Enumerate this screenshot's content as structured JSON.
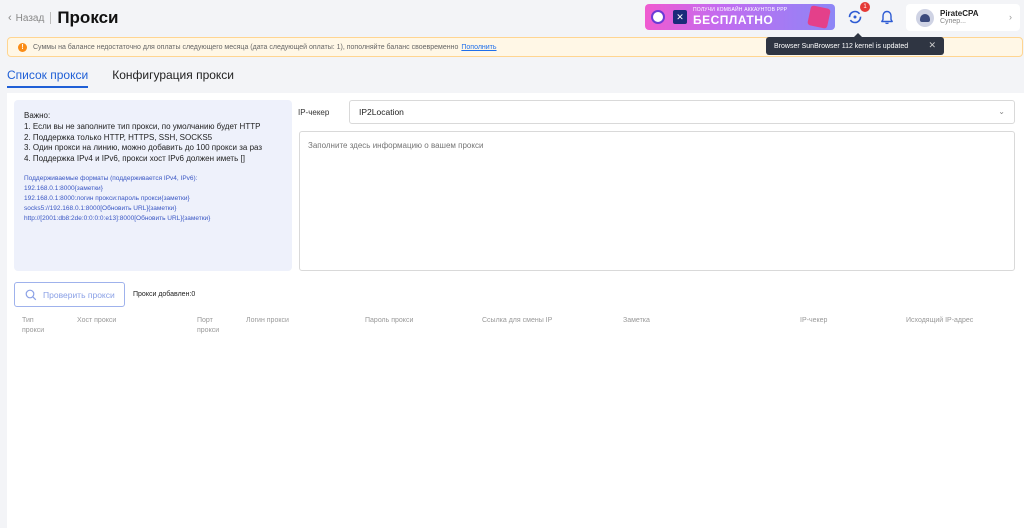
{
  "header": {
    "back_label": "Назад",
    "title": "Прокси"
  },
  "promo": {
    "line1": "ПОЛУЧИ КОМБАЙН АККАУНТОВ PPP",
    "line2": "БЕСПЛАТНО"
  },
  "notifications": {
    "badge_count": "1"
  },
  "user": {
    "name": "PirateCPA",
    "role": "Супер..."
  },
  "alert": {
    "text": "Суммы на балансе недостаточно для оплаты следующего месяца (дата следующей оплаты: 1), пополняйте баланс своевременно",
    "link": "Пополнить"
  },
  "tooltip": {
    "text": "Browser SunBrowser 112 kernel is updated"
  },
  "tabs": [
    {
      "label": "Список прокси",
      "active": true
    },
    {
      "label": "Конфигурация прокси",
      "active": false
    }
  ],
  "info": {
    "heading": "Важно:",
    "lines": [
      "1. Если вы не заполните тип прокси, по умолчанию будет HTTP",
      "2. Поддержка только HTTP, HTTPS, SSH, SOCKS5",
      "3. Один прокси на линию, можно добавить до 100 прокси за раз",
      "4. Поддержка IPv4 и IPv6, прокси хост IPv6 должен иметь []"
    ],
    "formats": [
      "Поддерживаемые форматы (поддерживается IPv4, IPv6):",
      "192.168.0.1:8000{заметки}",
      "192.168.0.1:8000:логин прокси:пароль прокси{заметки}",
      "socks5://192.168.0.1:8000[Обновить URL]{заметки}",
      "http://[2001:db8:2de:0:0:0:0:e13]:8000[Обновить URL]{заметки}"
    ]
  },
  "ip_checker": {
    "label": "IP-чекер",
    "value": "IP2Location"
  },
  "proxy_input": {
    "placeholder": "Заполните здесь информацию о вашем прокси"
  },
  "check_button": {
    "label": "Проверить прокси"
  },
  "added_label": "Прокси добавлен:0",
  "table": {
    "columns": [
      "Тип прокси",
      "Хост прокси",
      "Порт прокси",
      "Логин прокси",
      "Пароль прокси",
      "Ссылка для смены IP",
      "Заметка",
      "IP-чекер",
      "Исходящий IP-адрес"
    ]
  },
  "colors": {
    "accent": "#1f5fd6",
    "warning": "#fa8c16",
    "info_bg": "#eef1fb"
  }
}
